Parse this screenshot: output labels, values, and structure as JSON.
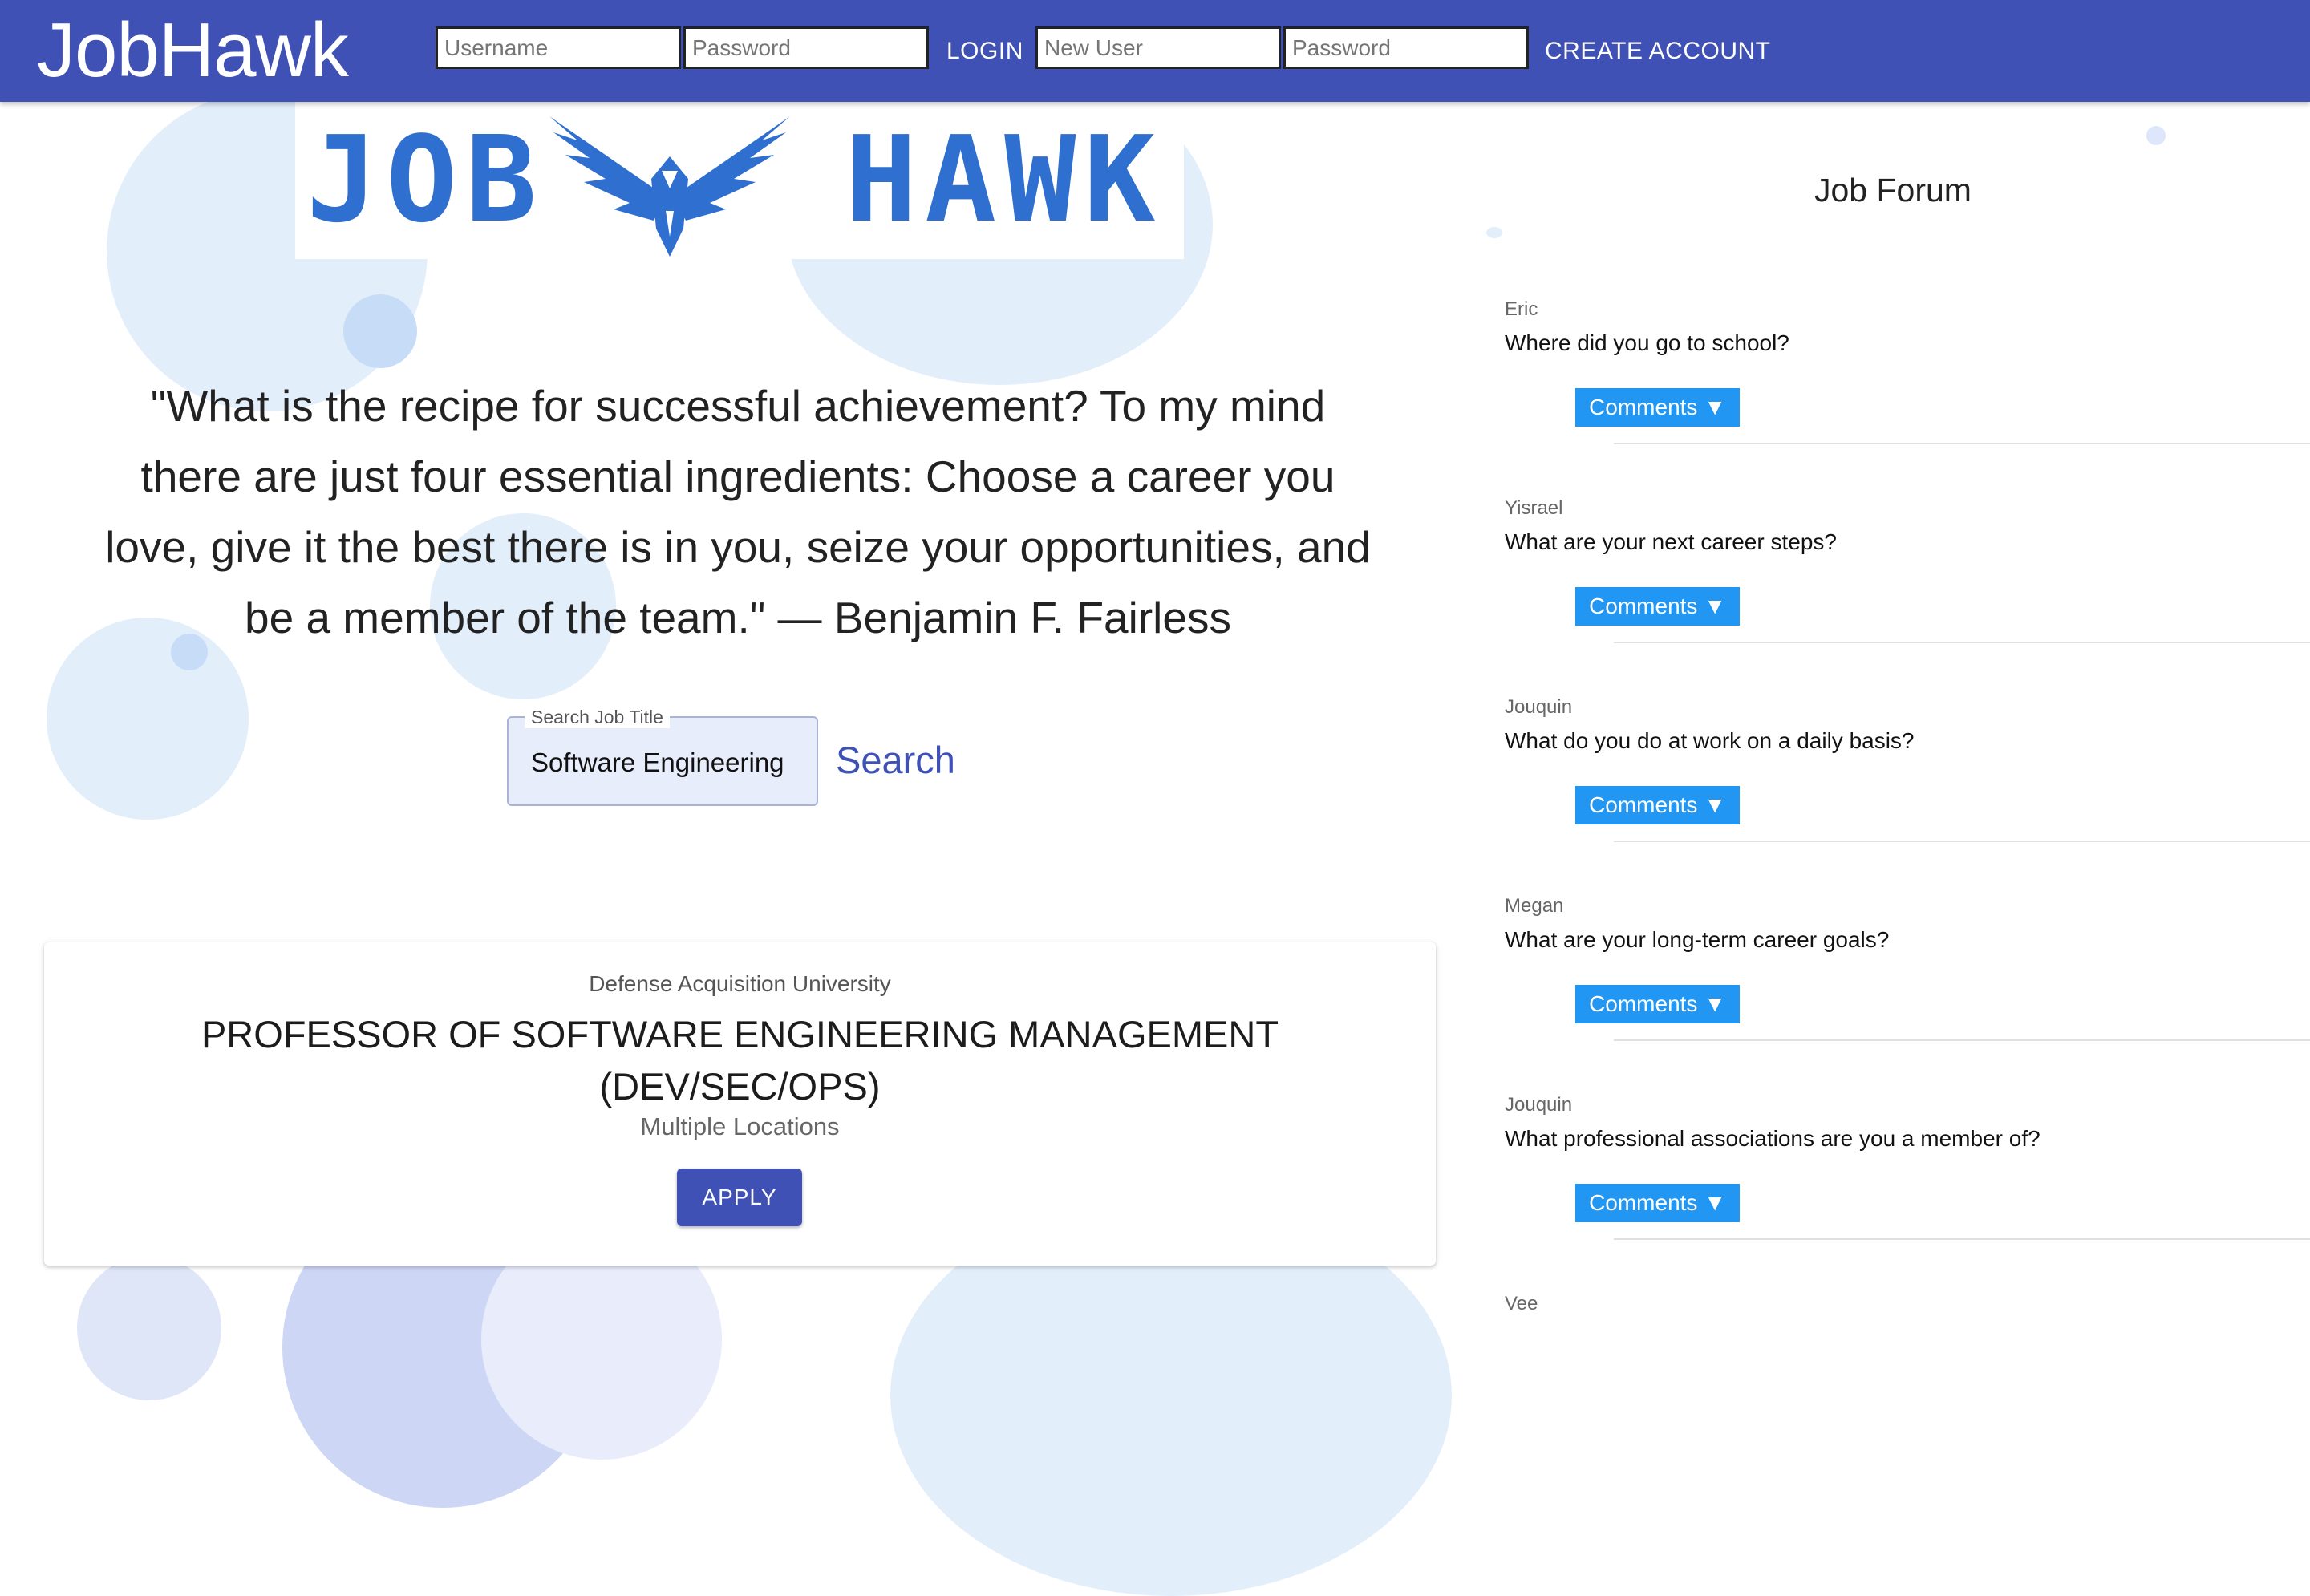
{
  "header": {
    "brand": "JobHawk",
    "login": {
      "username_placeholder": "Username",
      "password_placeholder": "Password",
      "button_label": "LOGIN"
    },
    "signup": {
      "new_user_placeholder": "New User",
      "password_placeholder": "Password",
      "button_label": "CREATE ACCOUNT"
    }
  },
  "logo": {
    "left_word": "JOB",
    "right_word": "HAWK"
  },
  "quote": "\"What is the recipe for successful achievement? To my mind there are just four essential ingredients: Choose a career you love, give it the best there is in you, seize your opportunities, and be a member of the team.\" — Benjamin F. Fairless",
  "search": {
    "label": "Search Job Title",
    "value": "Software Engineering",
    "button_label": "Search"
  },
  "job": {
    "company": "Defense Acquisition University",
    "title": "PROFESSOR OF SOFTWARE ENGINEERING MANAGEMENT (DEV/SEC/OPS)",
    "location": "Multiple Locations",
    "apply_label": "APPLY"
  },
  "forum": {
    "title": "Job Forum",
    "comments_label": "Comments ▼",
    "posts": [
      {
        "author": "Eric",
        "question": "Where did you go to school?"
      },
      {
        "author": "Yisrael",
        "question": "What are your next career steps?"
      },
      {
        "author": "Jouquin",
        "question": "What do you do at work on a daily basis?"
      },
      {
        "author": "Megan",
        "question": "What are your long-term career goals?"
      },
      {
        "author": "Jouquin",
        "question": "What professional associations are you a member of?"
      },
      {
        "author": "Vee",
        "question": ""
      }
    ]
  },
  "colors": {
    "primary": "#3f51b5",
    "comments_button": "#2196f3",
    "logo_blue": "#2f6fd0",
    "bubble_light": "#e3eefb",
    "bubble_mid": "#c7dcf6"
  }
}
